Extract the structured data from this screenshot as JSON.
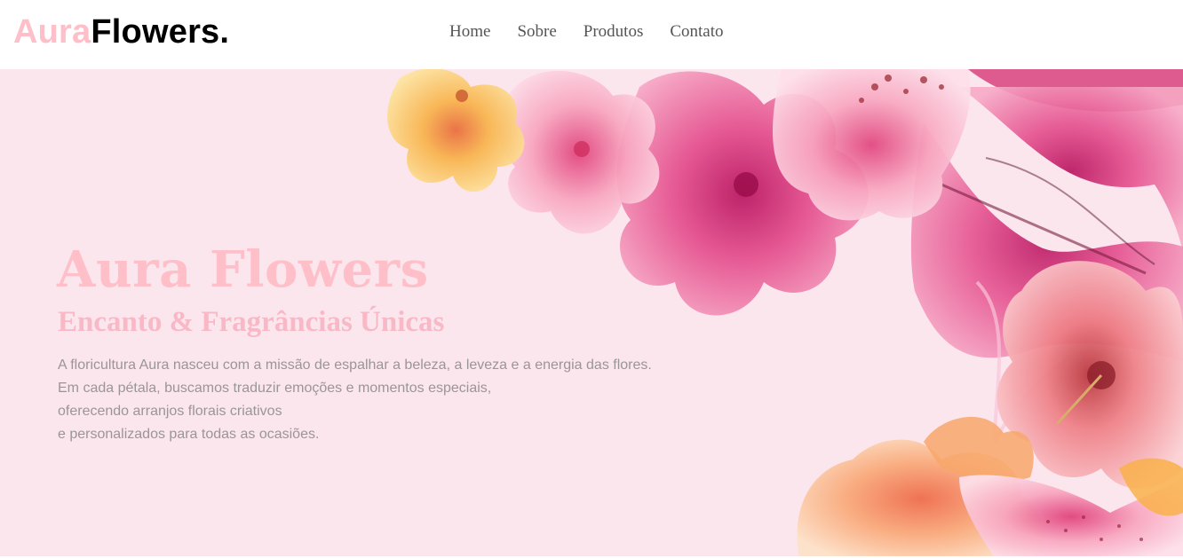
{
  "header": {
    "logo": {
      "part1": "Aura",
      "part2": "Flowers."
    },
    "nav": [
      {
        "label": "Home"
      },
      {
        "label": "Sobre"
      },
      {
        "label": "Produtos"
      },
      {
        "label": "Contato"
      }
    ]
  },
  "hero": {
    "title": "Aura Flowers",
    "subtitle": "Encanto & Fragrâncias Únicas",
    "body_lines": [
      "A floricultura Aura nasceu com a missão de espalhar a beleza, a leveza e a energia das flores.",
      "Em cada pétala, buscamos traduzir emoções e momentos especiais,",
      "oferecendo arranjos florais criativos",
      "e personalizados para todas as ocasiões."
    ]
  },
  "colors": {
    "brand_pink": "#ffbfc9",
    "hero_background": "#fce6ee",
    "nav_text": "#555555",
    "body_text": "#9a9598"
  }
}
